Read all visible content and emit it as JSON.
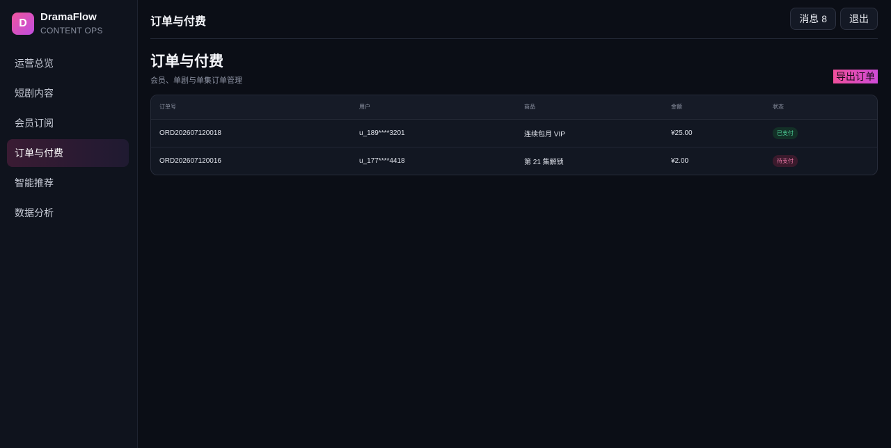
{
  "brand": {
    "logo_letter": "D",
    "name": "DramaFlow",
    "subtitle": "CONTENT OPS"
  },
  "nav": {
    "items": [
      {
        "label": "运营总览",
        "active": false
      },
      {
        "label": "短剧内容",
        "active": false
      },
      {
        "label": "会员订阅",
        "active": false
      },
      {
        "label": "订单与付费",
        "active": true
      },
      {
        "label": "智能推荐",
        "active": false
      },
      {
        "label": "数据分析",
        "active": false
      }
    ]
  },
  "topbar": {
    "title": "订单与付费",
    "messages_label": "消息 8",
    "logout_label": "退出"
  },
  "page": {
    "title": "订单与付费",
    "subtitle": "会员、单剧与单集订单管理",
    "export_label": "导出订单"
  },
  "table": {
    "columns": [
      "订单号",
      "用户",
      "商品",
      "金额",
      "状态"
    ],
    "rows": [
      {
        "order_id": "ORD202607120018",
        "user": "u_189****3201",
        "product": "连续包月 VIP",
        "amount": "¥25.00",
        "status": "已支付"
      },
      {
        "order_id": "ORD202607120016",
        "user": "u_177****4418",
        "product": "第 21 集解锁",
        "amount": "¥2.00",
        "status": "待支付"
      }
    ]
  },
  "colors": {
    "accent": "#ef4f9b",
    "paid": "#4fd39a",
    "pending": "#ee7aa9"
  }
}
